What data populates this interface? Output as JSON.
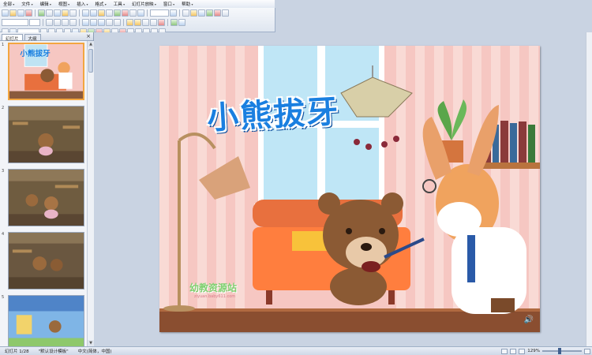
{
  "menubar": {
    "items": [
      "全部",
      "文件",
      "编辑",
      "视图",
      "插入",
      "格式",
      "工具",
      "幻灯片放映",
      "窗口",
      "帮助"
    ]
  },
  "panel": {
    "tabs": [
      "幻灯片",
      "大纲"
    ],
    "close_glyph": "×",
    "thumbnails": [
      {
        "num": "1",
        "selected": true
      },
      {
        "num": "2",
        "selected": false
      },
      {
        "num": "3",
        "selected": false
      },
      {
        "num": "4",
        "selected": false
      },
      {
        "num": "5",
        "selected": false
      }
    ]
  },
  "slide": {
    "title": "小熊拔牙",
    "watermark": "幼教资源站",
    "watermark_url": "ziyuan.baby611.com"
  },
  "statusbar": {
    "slide_info": "幻灯片 1/28",
    "design": "\"默认设计模板\"",
    "language": "中文(简体，中国)",
    "zoom": "129%"
  },
  "colors": {
    "accent": "#1a7fe0",
    "selection": "#f3a640",
    "wall": "#f6c7c2",
    "sofa": "#e8703e"
  }
}
